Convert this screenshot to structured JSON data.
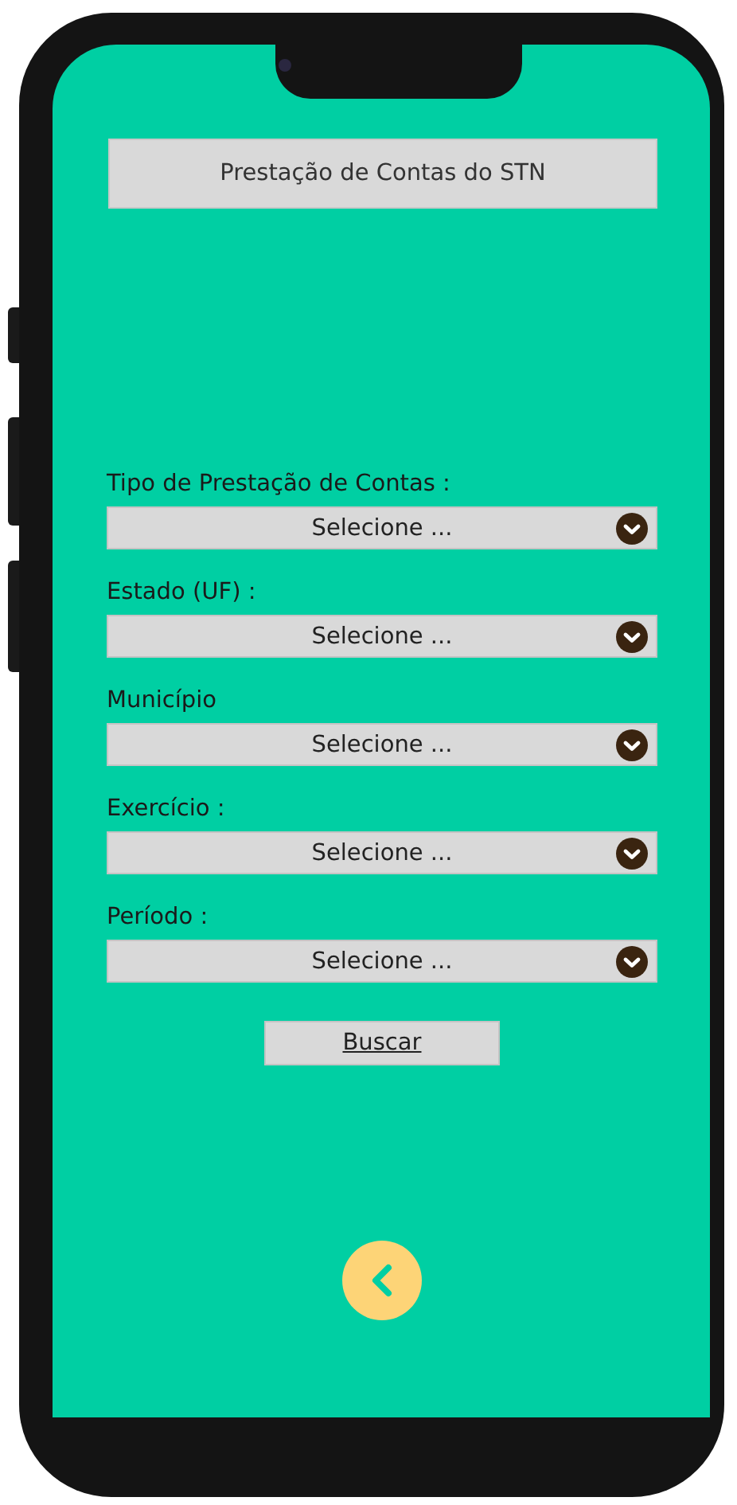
{
  "title": "Prestação de Contas do STN",
  "fields": [
    {
      "label": "Tipo de Prestação de Contas :",
      "value": "Selecione ..."
    },
    {
      "label": "Estado (UF) :",
      "value": "Selecione ..."
    },
    {
      "label": "Município",
      "value": "Selecione ..."
    },
    {
      "label": "Exercício :",
      "value": "Selecione ..."
    },
    {
      "label": "Período :",
      "value": "Selecione ..."
    }
  ],
  "search_button": "Buscar"
}
